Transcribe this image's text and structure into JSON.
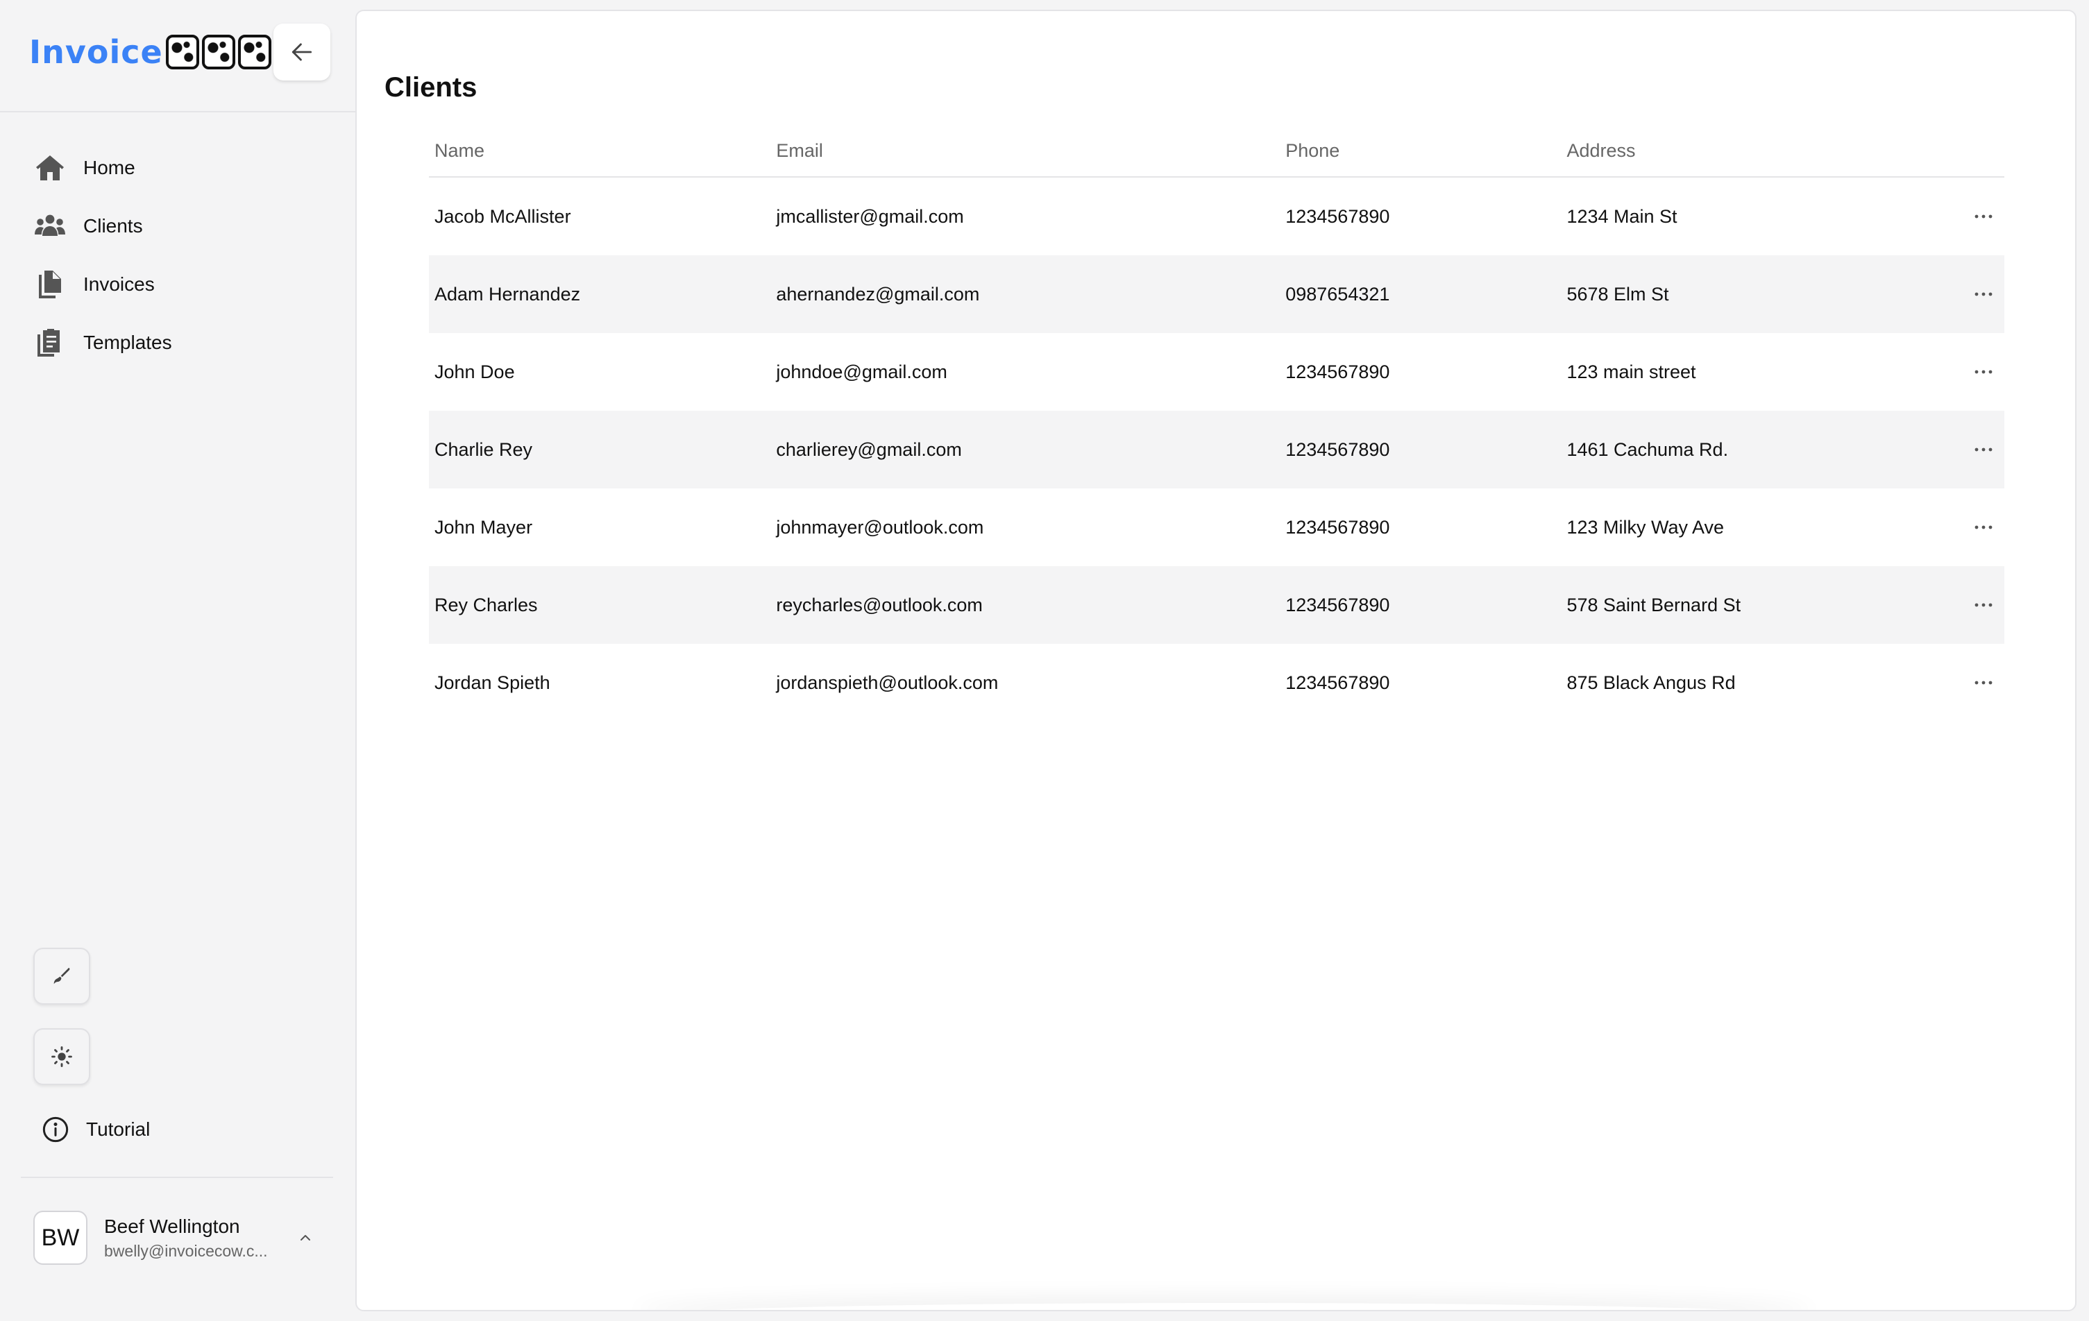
{
  "brand": {
    "prefix": "Invoice",
    "suffix": "COW"
  },
  "sidebar": {
    "nav": [
      {
        "label": "Home",
        "icon": "home-icon"
      },
      {
        "label": "Clients",
        "icon": "users-icon"
      },
      {
        "label": "Invoices",
        "icon": "documents-icon"
      },
      {
        "label": "Templates",
        "icon": "clipboard-icon"
      }
    ],
    "tools": [
      {
        "icon": "paintbrush-icon"
      },
      {
        "icon": "sun-icon"
      }
    ],
    "tutorial_label": "Tutorial",
    "user": {
      "initials": "BW",
      "name": "Beef Wellington",
      "email": "bwelly@invoicecow.c..."
    }
  },
  "main": {
    "title": "Clients",
    "columns": [
      "Name",
      "Email",
      "Phone",
      "Address"
    ],
    "rows": [
      {
        "name": "Jacob McAllister",
        "email": "jmcallister@gmail.com",
        "phone": "1234567890",
        "address": "1234 Main St"
      },
      {
        "name": "Adam Hernandez",
        "email": "ahernandez@gmail.com",
        "phone": "0987654321",
        "address": "5678 Elm St"
      },
      {
        "name": "John Doe",
        "email": "johndoe@gmail.com",
        "phone": "1234567890",
        "address": "123 main street"
      },
      {
        "name": "Charlie Rey",
        "email": "charlierey@gmail.com",
        "phone": "1234567890",
        "address": "1461 Cachuma Rd."
      },
      {
        "name": "John Mayer",
        "email": "johnmayer@outlook.com",
        "phone": "1234567890",
        "address": "123 Milky Way Ave"
      },
      {
        "name": "Rey Charles",
        "email": "reycharles@outlook.com",
        "phone": "1234567890",
        "address": "578 Saint Bernard St"
      },
      {
        "name": "Jordan Spieth",
        "email": "jordanspieth@outlook.com",
        "phone": "1234567890",
        "address": "875 Black Angus Rd"
      }
    ]
  },
  "colors": {
    "brand": "#3b82f6",
    "sidebar_bg": "#f4f4f5",
    "stripe": "#f4f4f5",
    "text": "#111111",
    "muted": "#666666"
  }
}
